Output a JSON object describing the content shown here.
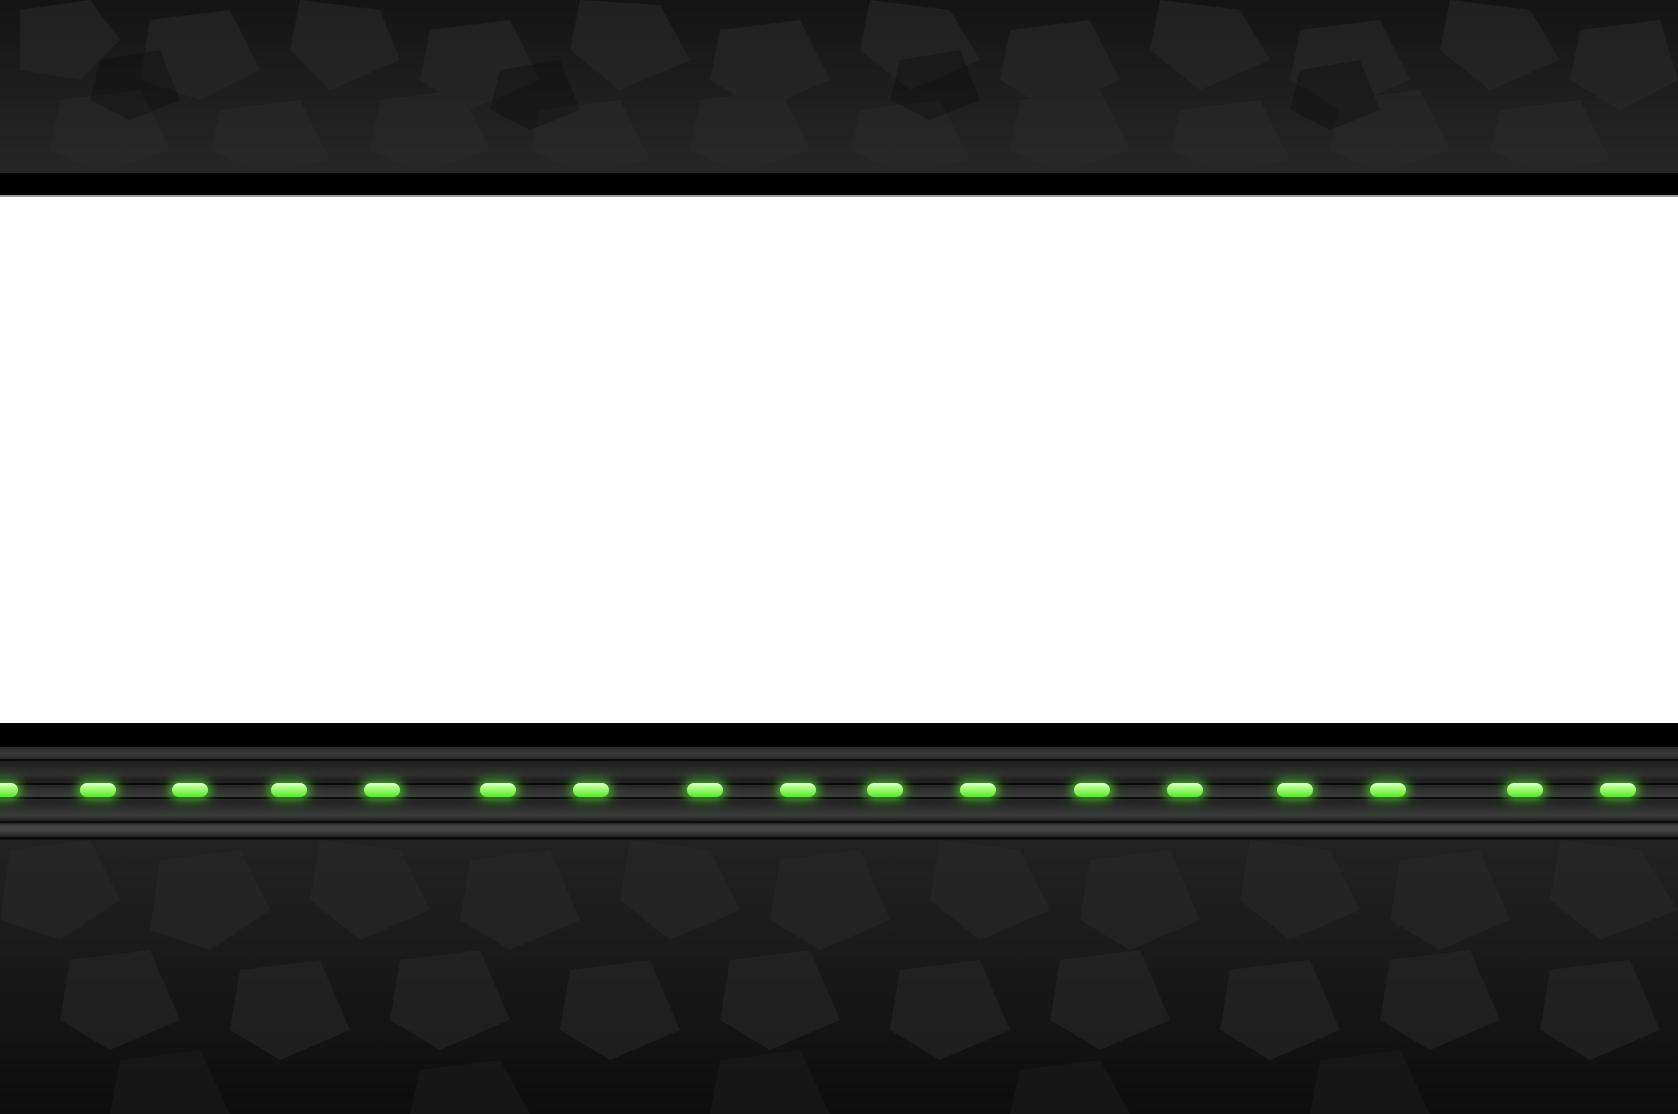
{
  "scene": {
    "background_color": "#111111",
    "play_area_color": "#ffffff",
    "border_color": "#000000",
    "led_color": "#5be82d",
    "led_glow_color": "#a8ff7a",
    "rock_texture": "dark-cobblestone",
    "led_count": 18
  }
}
